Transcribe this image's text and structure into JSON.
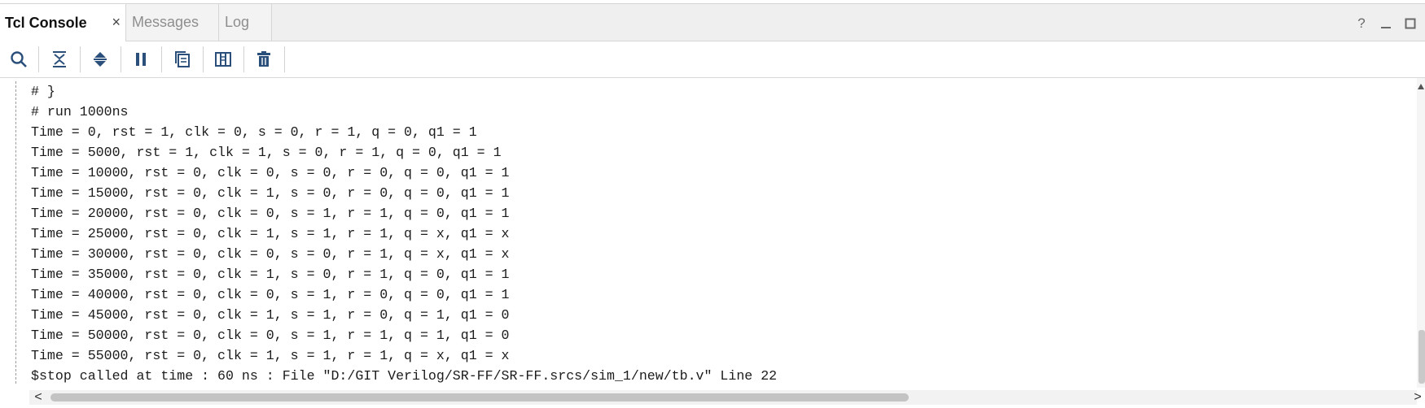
{
  "tabs": [
    {
      "label": "Tcl Console",
      "active": true,
      "close": "×"
    },
    {
      "label": "Messages",
      "active": false
    },
    {
      "label": "Log",
      "active": false
    }
  ],
  "window_controls": {
    "help": "?",
    "minimize": "—",
    "maximize": "□"
  },
  "toolbar": {
    "icons": [
      "search-icon",
      "collapse-all-icon",
      "expand-all-icon",
      "pause-icon",
      "copy-icon",
      "columns-icon",
      "clear-icon"
    ]
  },
  "console": {
    "lines": [
      "# }",
      "# run 1000ns",
      "Time = 0, rst = 1, clk = 0, s = 0, r = 1, q = 0, q1 = 1",
      "Time = 5000, rst = 1, clk = 1, s = 0, r = 1, q = 0, q1 = 1",
      "Time = 10000, rst = 0, clk = 0, s = 0, r = 0, q = 0, q1 = 1",
      "Time = 15000, rst = 0, clk = 1, s = 0, r = 0, q = 0, q1 = 1",
      "Time = 20000, rst = 0, clk = 0, s = 1, r = 1, q = 0, q1 = 1",
      "Time = 25000, rst = 0, clk = 1, s = 1, r = 1, q = x, q1 = x",
      "Time = 30000, rst = 0, clk = 0, s = 0, r = 1, q = x, q1 = x",
      "Time = 35000, rst = 0, clk = 1, s = 0, r = 1, q = 0, q1 = 1",
      "Time = 40000, rst = 0, clk = 0, s = 1, r = 0, q = 0, q1 = 1",
      "Time = 45000, rst = 0, clk = 1, s = 1, r = 0, q = 1, q1 = 0",
      "Time = 50000, rst = 0, clk = 0, s = 1, r = 1, q = 1, q1 = 0",
      "Time = 55000, rst = 0, clk = 1, s = 1, r = 1, q = x, q1 = x",
      "$stop called at time : 60 ns : File \"D:/GIT Verilog/SR-FF/SR-FF.srcs/sim_1/new/tb.v\" Line 22"
    ]
  },
  "scrollbars": {
    "left_arrow": "<",
    "right_arrow": ">",
    "up_arrow": "▲"
  },
  "colors": {
    "icon": "#2a4f7a",
    "tab_active_bg": "#ffffff",
    "tab_bar_bg": "#efefef"
  }
}
